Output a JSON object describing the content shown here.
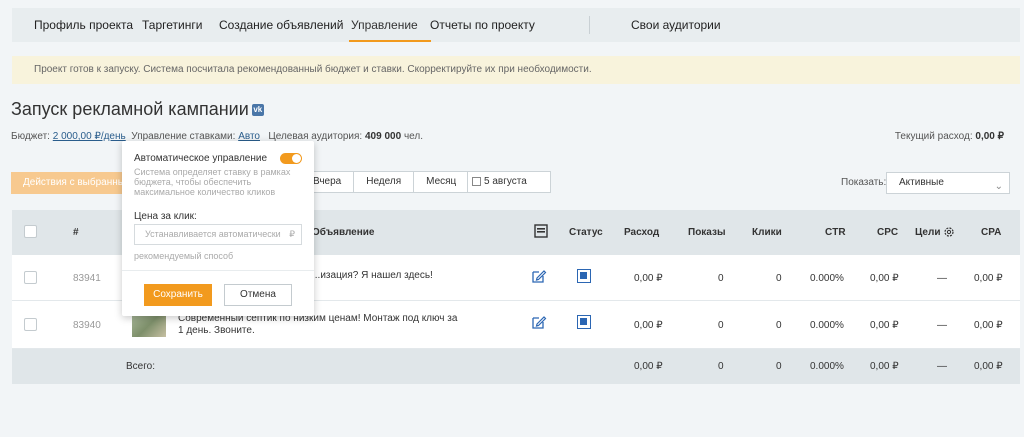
{
  "nav": {
    "tabs": [
      {
        "label": "Профиль проекта"
      },
      {
        "label": "Таргетинги"
      },
      {
        "label": "Создание объявлений"
      },
      {
        "label": "Управление"
      },
      {
        "label": "Отчеты по проекту"
      },
      {
        "label": "Свои аудитории"
      }
    ],
    "active_tab": "Управление"
  },
  "notice": "Проект готов к запуску. Система посчитала рекомендованный бюджет и ставки. Скорректируйте их при необходимости.",
  "page": {
    "title": "Запуск рекламной кампании",
    "badge": "vk"
  },
  "info": {
    "budget_label": "Бюджет:",
    "budget_value": "2 000,00 ₽/день",
    "rate_label": "Управление ставками:",
    "rate_value": "Авто",
    "audience_label": "Целевая аудитория:",
    "audience_value": "409 000",
    "audience_unit": "чел.",
    "spend_label": "Текущий расход:",
    "spend_value": "0,00 ₽"
  },
  "toolbar": {
    "actions_label": "Действия с выбранными",
    "periods": [
      "Вчера",
      "Неделя",
      "Месяц"
    ],
    "date": "5 августа",
    "show_label": "Показать:",
    "show_value": "Активные"
  },
  "table": {
    "headers": {
      "num": "#",
      "name": "Объявление",
      "status": "Статус",
      "spend": "Расход",
      "shows": "Показы",
      "clicks": "Клики",
      "ctr": "CTR",
      "cpc": "CPC",
      "goals": "Цели",
      "cpa": "CPA"
    },
    "rows": [
      {
        "id": "83941",
        "text": "...изация? Я нашел здесь!",
        "spend": "0,00 ₽",
        "shows": "0",
        "clicks": "0",
        "ctr": "0.000%",
        "cpc": "0,00 ₽",
        "goals": "—",
        "cpa": "0,00 ₽"
      },
      {
        "id": "83940",
        "text": "Современный септик по низким ценам! Монтаж под ключ за 1 день. Звоните.",
        "spend": "0,00 ₽",
        "shows": "0",
        "clicks": "0",
        "ctr": "0.000%",
        "cpc": "0,00 ₽",
        "goals": "—",
        "cpa": "0,00 ₽"
      }
    ],
    "total": {
      "label": "Всего:",
      "spend": "0,00 ₽",
      "shows": "0",
      "clicks": "0",
      "ctr": "0.000%",
      "cpc": "0,00 ₽",
      "goals": "—",
      "cpa": "0,00 ₽"
    }
  },
  "popup": {
    "title": "Автоматическое управление",
    "description": "Система определяет ставку в рамках бюджета, чтобы обеспечить максимальное количество кликов",
    "price_label": "Цена за клик:",
    "price_placeholder": "Устанавливается автоматически",
    "currency": "₽",
    "hint": "рекомендуемый способ",
    "save_label": "Сохранить",
    "cancel_label": "Отмена"
  },
  "colors": {
    "accent": "#f29a1e",
    "status_blue": "#2b66b3",
    "link": "#2a5d8c"
  }
}
